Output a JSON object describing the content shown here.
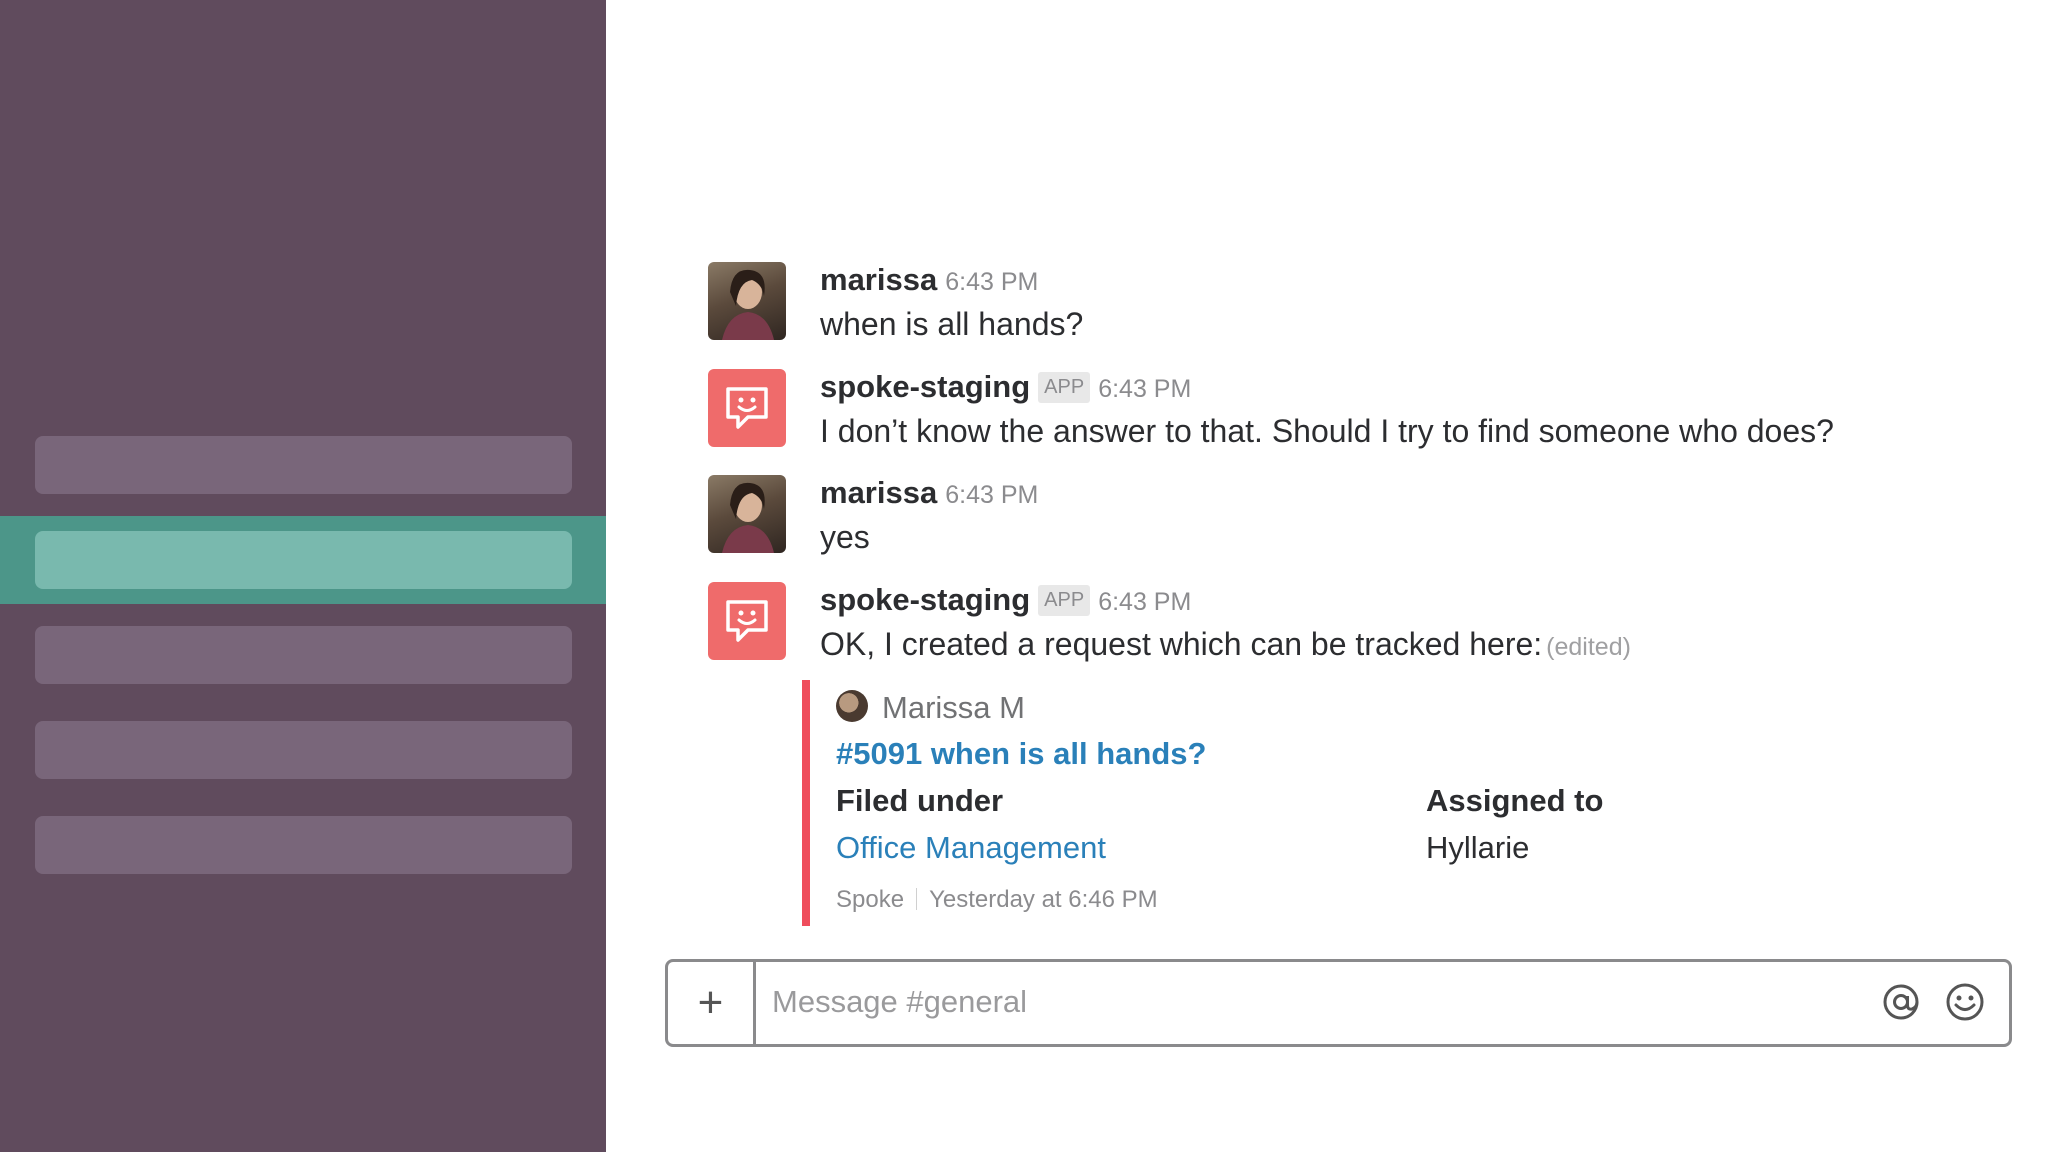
{
  "messages": [
    {
      "author": "marissa",
      "time": "6:43 PM",
      "text": "when is all hands?"
    },
    {
      "author": "spoke-staging",
      "badge": "APP",
      "time": "6:43 PM",
      "text": "I don’t know the answer to that. Should I try to find someone who does?"
    },
    {
      "author": "marissa",
      "time": "6:43 PM",
      "text": "yes"
    },
    {
      "author": "spoke-staging",
      "badge": "APP",
      "time": "6:43 PM",
      "text": "OK, I created a request which can be tracked here:",
      "edited": "(edited)"
    }
  ],
  "attachment": {
    "author": "Marissa M",
    "title": "#5091 when is all hands?",
    "fields": [
      {
        "label": "Filed under",
        "value": "Office Management"
      },
      {
        "label": "Assigned to",
        "value": "Hyllarie"
      }
    ],
    "footer_source": "Spoke",
    "footer_time": "Yesterday at 6:46 PM"
  },
  "composer": {
    "plus": "+",
    "placeholder": "Message #general"
  },
  "colors": {
    "sidebar": "#604b5d",
    "sidebar_active": "#4c9689",
    "bot_avatar": "#ef6b6b",
    "attachment_bar": "#ef4d5c",
    "link": "#2a80b9"
  }
}
